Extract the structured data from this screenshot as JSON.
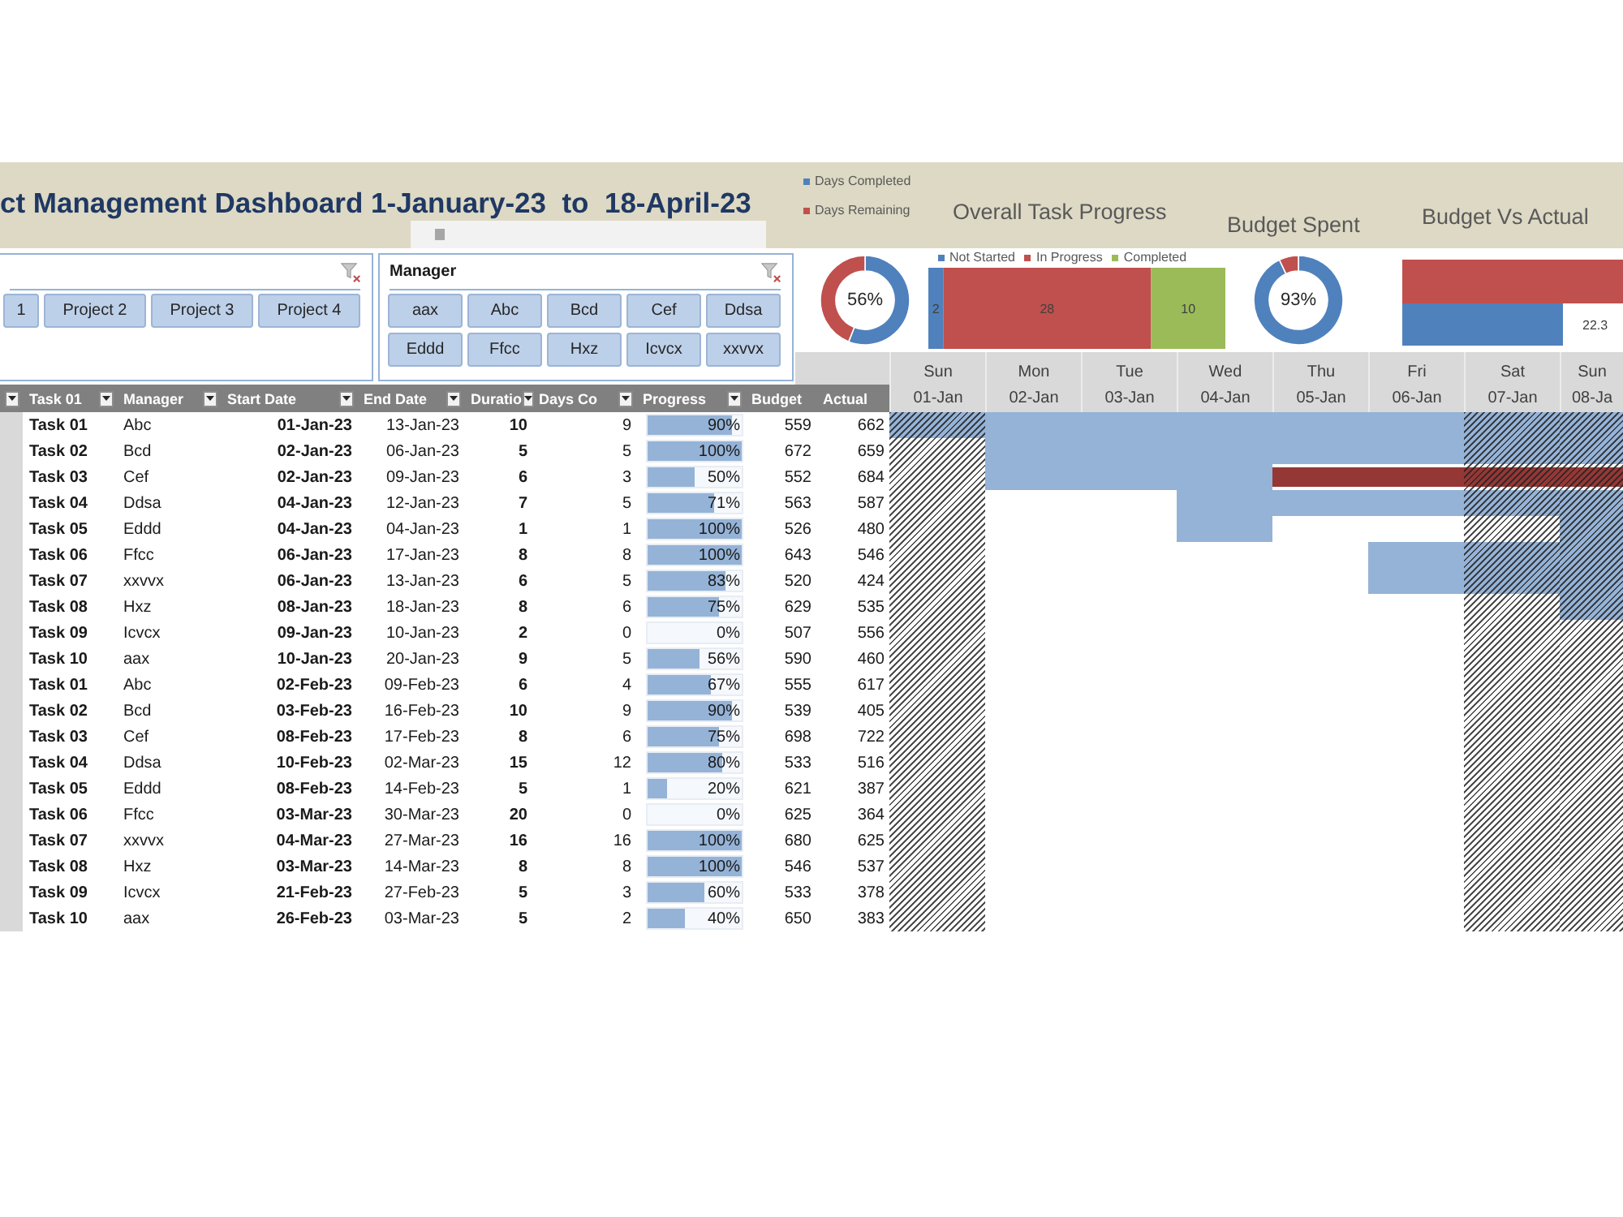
{
  "header": {
    "title": "ct Management Dashboard 1-January-23  to  18-April-23",
    "legend": [
      {
        "label": "Days Completed",
        "color": "#4f81bd"
      },
      {
        "label": "Days Remaining",
        "color": "#c0504d"
      }
    ],
    "chart_titles": [
      "Overall Task Progress",
      "Budget Spent",
      "Budget Vs Actual"
    ]
  },
  "slicers": [
    {
      "items": [
        {
          "label": "1",
          "selected": true
        },
        {
          "label": "Project 2",
          "selected": true
        },
        {
          "label": "Project 3",
          "selected": true
        },
        {
          "label": "Project 4",
          "selected": true
        }
      ]
    },
    {
      "title": "Manager",
      "items": [
        {
          "label": "aax",
          "selected": true
        },
        {
          "label": "Abc",
          "selected": true
        },
        {
          "label": "Bcd",
          "selected": true
        },
        {
          "label": "Cef",
          "selected": true
        },
        {
          "label": "Ddsa",
          "selected": true
        },
        {
          "label": "Eddd",
          "selected": true
        },
        {
          "label": "Ffcc",
          "selected": true
        },
        {
          "label": "Hxz",
          "selected": true
        },
        {
          "label": "Icvcx",
          "selected": true
        },
        {
          "label": "xxvvx",
          "selected": true
        }
      ]
    }
  ],
  "charts": {
    "days_donut": {
      "chart_data": {
        "type": "donut",
        "values": [
          56,
          44
        ],
        "annotations": [
          {
            "text": "56%"
          }
        ]
      }
    },
    "task_status": {
      "chart_data": {
        "type": "bar",
        "orientation": "horizontal",
        "stacked": true,
        "legend": "top",
        "data_labels": true,
        "series": [
          {
            "name": "Not Started",
            "color": "#4f81bd",
            "values": [
              2
            ]
          },
          {
            "name": "In Progress",
            "color": "#c0504d",
            "values": [
              28
            ]
          },
          {
            "name": "Completed",
            "color": "#9bbb59",
            "values": [
              10
            ]
          }
        ]
      }
    },
    "budget_donut": {
      "chart_data": {
        "type": "donut",
        "values": [
          93,
          7
        ],
        "annotations": [
          {
            "text": "93%"
          }
        ]
      }
    },
    "budget_vs_actual": {
      "value_label": "22.3"
    }
  },
  "table": {
    "side_column": {
      "filter": true
    },
    "columns": [
      {
        "label": "Task 01",
        "kind": "key",
        "filter": true
      },
      {
        "label": "Manager",
        "kind": "text",
        "filter": true
      },
      {
        "label": "Start Date",
        "kind": "strong",
        "filter": true
      },
      {
        "label": "End Date",
        "kind": "plain",
        "filter": true
      },
      {
        "label": "Duratio",
        "kind": "strong",
        "filter": true
      },
      {
        "label": "Days Co",
        "kind": "plain",
        "filter": true
      },
      {
        "label": "Progress",
        "kind": "progress",
        "filter": true
      },
      {
        "label": "Budget",
        "kind": "plain",
        "filter": false
      },
      {
        "label": "Actual",
        "kind": "plain",
        "filter": false
      }
    ],
    "rows": [
      {
        "cells": [
          "Task 01",
          "Abc",
          "01-Jan-23",
          "13-Jan-23",
          "10",
          "9",
          "90%",
          "559",
          "662"
        ],
        "level": 0.9
      },
      {
        "cells": [
          "Task 02",
          "Bcd",
          "02-Jan-23",
          "06-Jan-23",
          "5",
          "5",
          "100%",
          "672",
          "659"
        ],
        "level": 1
      },
      {
        "cells": [
          "Task 03",
          "Cef",
          "02-Jan-23",
          "09-Jan-23",
          "6",
          "3",
          "50%",
          "552",
          "684"
        ],
        "level": 0.5
      },
      {
        "cells": [
          "Task 04",
          "Ddsa",
          "04-Jan-23",
          "12-Jan-23",
          "7",
          "5",
          "71%",
          "563",
          "587"
        ],
        "level": 0.71
      },
      {
        "cells": [
          "Task 05",
          "Eddd",
          "04-Jan-23",
          "04-Jan-23",
          "1",
          "1",
          "100%",
          "526",
          "480"
        ],
        "level": 1
      },
      {
        "cells": [
          "Task 06",
          "Ffcc",
          "06-Jan-23",
          "17-Jan-23",
          "8",
          "8",
          "100%",
          "643",
          "546"
        ],
        "level": 1
      },
      {
        "cells": [
          "Task 07",
          "xxvvx",
          "06-Jan-23",
          "13-Jan-23",
          "6",
          "5",
          "83%",
          "520",
          "424"
        ],
        "level": 0.83
      },
      {
        "cells": [
          "Task 08",
          "Hxz",
          "08-Jan-23",
          "18-Jan-23",
          "8",
          "6",
          "75%",
          "629",
          "535"
        ],
        "level": 0.75
      },
      {
        "cells": [
          "Task 09",
          "Icvcx",
          "09-Jan-23",
          "10-Jan-23",
          "2",
          "0",
          "0%",
          "507",
          "556"
        ]
      },
      {
        "cells": [
          "Task 10",
          "aax",
          "10-Jan-23",
          "20-Jan-23",
          "9",
          "5",
          "56%",
          "590",
          "460"
        ],
        "level": 0.56
      },
      {
        "cells": [
          "Task 01",
          "Abc",
          "02-Feb-23",
          "09-Feb-23",
          "6",
          "4",
          "67%",
          "555",
          "617"
        ],
        "level": 0.67
      },
      {
        "cells": [
          "Task 02",
          "Bcd",
          "03-Feb-23",
          "16-Feb-23",
          "10",
          "9",
          "90%",
          "539",
          "405"
        ],
        "level": 0.9
      },
      {
        "cells": [
          "Task 03",
          "Cef",
          "08-Feb-23",
          "17-Feb-23",
          "8",
          "6",
          "75%",
          "698",
          "722"
        ],
        "level": 0.75
      },
      {
        "cells": [
          "Task 04",
          "Ddsa",
          "10-Feb-23",
          "02-Mar-23",
          "15",
          "12",
          "80%",
          "533",
          "516"
        ],
        "level": 0.8
      },
      {
        "cells": [
          "Task 05",
          "Eddd",
          "08-Feb-23",
          "14-Feb-23",
          "5",
          "1",
          "20%",
          "621",
          "387"
        ],
        "level": 0.2
      },
      {
        "cells": [
          "Task 06",
          "Ffcc",
          "03-Mar-23",
          "30-Mar-23",
          "20",
          "0",
          "0%",
          "625",
          "364"
        ]
      },
      {
        "cells": [
          "Task 07",
          "xxvvx",
          "04-Mar-23",
          "27-Mar-23",
          "16",
          "16",
          "100%",
          "680",
          "625"
        ],
        "level": 1
      },
      {
        "cells": [
          "Task 08",
          "Hxz",
          "03-Mar-23",
          "14-Mar-23",
          "8",
          "8",
          "100%",
          "546",
          "537"
        ],
        "level": 1
      },
      {
        "cells": [
          "Task 09",
          "Icvcx",
          "21-Feb-23",
          "27-Feb-23",
          "5",
          "3",
          "60%",
          "533",
          "378"
        ],
        "level": 0.6
      },
      {
        "cells": [
          "Task 10",
          "aax",
          "26-Feb-23",
          "03-Mar-23",
          "5",
          "2",
          "40%",
          "650",
          "383"
        ],
        "level": 0.4
      }
    ]
  },
  "gantt": {
    "days": [
      {
        "day": "Sun",
        "date": "01-Jan",
        "weekend": true
      },
      {
        "day": "Mon",
        "date": "02-Jan",
        "weekend": false
      },
      {
        "day": "Tue",
        "date": "03-Jan",
        "weekend": false
      },
      {
        "day": "Wed",
        "date": "04-Jan",
        "weekend": false
      },
      {
        "day": "Thu",
        "date": "05-Jan",
        "weekend": false
      },
      {
        "day": "Fri",
        "date": "06-Jan",
        "weekend": false
      },
      {
        "day": "Sat",
        "date": "07-Jan",
        "weekend": true
      },
      {
        "day": "Sun",
        "date": "08-Ja",
        "weekend": true
      }
    ],
    "rows": [
      {
        "cells": [
          {
            "kind": "done"
          },
          {
            "kind": "done"
          },
          {
            "kind": "done"
          },
          {
            "kind": "done"
          },
          {
            "kind": "done"
          },
          {
            "kind": "done"
          },
          {
            "kind": "done"
          },
          {
            "kind": "done"
          }
        ]
      },
      {
        "cells": [
          {
            "kind": "empty"
          },
          {
            "kind": "done"
          },
          {
            "kind": "done"
          },
          {
            "kind": "done"
          },
          {
            "kind": "done"
          },
          {
            "kind": "done"
          },
          {
            "kind": "done"
          },
          {
            "kind": "done"
          }
        ]
      },
      {
        "cells": [
          {
            "kind": "empty"
          },
          {
            "kind": "done"
          },
          {
            "kind": "done"
          },
          {
            "kind": "done"
          },
          {
            "kind": "late"
          },
          {
            "kind": "late"
          },
          {
            "kind": "late"
          },
          {
            "kind": "late"
          }
        ]
      },
      {
        "cells": [
          {
            "kind": "empty"
          },
          {
            "kind": "empty"
          },
          {
            "kind": "empty"
          },
          {
            "kind": "done"
          },
          {
            "kind": "done"
          },
          {
            "kind": "done"
          },
          {
            "kind": "done"
          },
          {
            "kind": "done"
          }
        ]
      },
      {
        "cells": [
          {
            "kind": "empty"
          },
          {
            "kind": "empty"
          },
          {
            "kind": "empty"
          },
          {
            "kind": "done"
          },
          {
            "kind": "empty"
          },
          {
            "kind": "empty"
          },
          {
            "kind": "empty"
          },
          {
            "kind": "done"
          }
        ]
      },
      {
        "cells": [
          {
            "kind": "empty"
          },
          {
            "kind": "empty"
          },
          {
            "kind": "empty"
          },
          {
            "kind": "empty"
          },
          {
            "kind": "empty"
          },
          {
            "kind": "done"
          },
          {
            "kind": "done"
          },
          {
            "kind": "done"
          }
        ]
      },
      {
        "cells": [
          {
            "kind": "empty"
          },
          {
            "kind": "empty"
          },
          {
            "kind": "empty"
          },
          {
            "kind": "empty"
          },
          {
            "kind": "empty"
          },
          {
            "kind": "done"
          },
          {
            "kind": "done"
          },
          {
            "kind": "done"
          }
        ]
      },
      {
        "cells": [
          {
            "kind": "empty"
          },
          {
            "kind": "empty"
          },
          {
            "kind": "empty"
          },
          {
            "kind": "empty"
          },
          {
            "kind": "empty"
          },
          {
            "kind": "empty"
          },
          {
            "kind": "empty"
          },
          {
            "kind": "done"
          }
        ]
      },
      {
        "cells": [
          {
            "kind": "empty"
          },
          {
            "kind": "empty"
          },
          {
            "kind": "empty"
          },
          {
            "kind": "empty"
          },
          {
            "kind": "empty"
          },
          {
            "kind": "empty"
          },
          {
            "kind": "empty"
          },
          {
            "kind": "empty"
          }
        ]
      },
      {
        "cells": [
          {
            "kind": "empty"
          },
          {
            "kind": "empty"
          },
          {
            "kind": "empty"
          },
          {
            "kind": "empty"
          },
          {
            "kind": "empty"
          },
          {
            "kind": "empty"
          },
          {
            "kind": "empty"
          },
          {
            "kind": "empty"
          }
        ]
      },
      {
        "cells": [
          {
            "kind": "empty"
          },
          {
            "kind": "empty"
          },
          {
            "kind": "empty"
          },
          {
            "kind": "empty"
          },
          {
            "kind": "empty"
          },
          {
            "kind": "empty"
          },
          {
            "kind": "empty"
          },
          {
            "kind": "empty"
          }
        ]
      },
      {
        "cells": [
          {
            "kind": "empty"
          },
          {
            "kind": "empty"
          },
          {
            "kind": "empty"
          },
          {
            "kind": "empty"
          },
          {
            "kind": "empty"
          },
          {
            "kind": "empty"
          },
          {
            "kind": "empty"
          },
          {
            "kind": "empty"
          }
        ]
      },
      {
        "cells": [
          {
            "kind": "empty"
          },
          {
            "kind": "empty"
          },
          {
            "kind": "empty"
          },
          {
            "kind": "empty"
          },
          {
            "kind": "empty"
          },
          {
            "kind": "empty"
          },
          {
            "kind": "empty"
          },
          {
            "kind": "empty"
          }
        ]
      },
      {
        "cells": [
          {
            "kind": "empty"
          },
          {
            "kind": "empty"
          },
          {
            "kind": "empty"
          },
          {
            "kind": "empty"
          },
          {
            "kind": "empty"
          },
          {
            "kind": "empty"
          },
          {
            "kind": "empty"
          },
          {
            "kind": "empty"
          }
        ]
      },
      {
        "cells": [
          {
            "kind": "empty"
          },
          {
            "kind": "empty"
          },
          {
            "kind": "empty"
          },
          {
            "kind": "empty"
          },
          {
            "kind": "empty"
          },
          {
            "kind": "empty"
          },
          {
            "kind": "empty"
          },
          {
            "kind": "empty"
          }
        ]
      },
      {
        "cells": [
          {
            "kind": "empty"
          },
          {
            "kind": "empty"
          },
          {
            "kind": "empty"
          },
          {
            "kind": "empty"
          },
          {
            "kind": "empty"
          },
          {
            "kind": "empty"
          },
          {
            "kind": "empty"
          },
          {
            "kind": "empty"
          }
        ]
      },
      {
        "cells": [
          {
            "kind": "empty"
          },
          {
            "kind": "empty"
          },
          {
            "kind": "empty"
          },
          {
            "kind": "empty"
          },
          {
            "kind": "empty"
          },
          {
            "kind": "empty"
          },
          {
            "kind": "empty"
          },
          {
            "kind": "empty"
          }
        ]
      },
      {
        "cells": [
          {
            "kind": "empty"
          },
          {
            "kind": "empty"
          },
          {
            "kind": "empty"
          },
          {
            "kind": "empty"
          },
          {
            "kind": "empty"
          },
          {
            "kind": "empty"
          },
          {
            "kind": "empty"
          },
          {
            "kind": "empty"
          }
        ]
      },
      {
        "cells": [
          {
            "kind": "empty"
          },
          {
            "kind": "empty"
          },
          {
            "kind": "empty"
          },
          {
            "kind": "empty"
          },
          {
            "kind": "empty"
          },
          {
            "kind": "empty"
          },
          {
            "kind": "empty"
          },
          {
            "kind": "empty"
          }
        ]
      },
      {
        "cells": [
          {
            "kind": "empty"
          },
          {
            "kind": "empty"
          },
          {
            "kind": "empty"
          },
          {
            "kind": "empty"
          },
          {
            "kind": "empty"
          },
          {
            "kind": "empty"
          },
          {
            "kind": "empty"
          },
          {
            "kind": "empty"
          }
        ]
      }
    ]
  }
}
